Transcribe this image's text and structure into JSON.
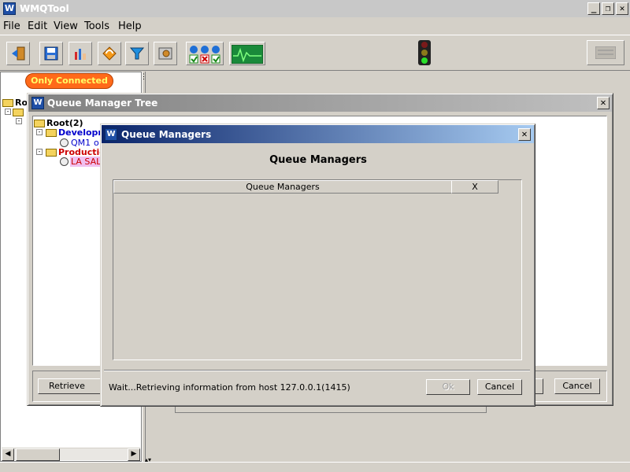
{
  "app": {
    "title": "WMQTool",
    "logo_letter": "W"
  },
  "window_controls": {
    "minimize": "_",
    "restore": "❐",
    "close": "✕"
  },
  "menu": {
    "items": [
      "File",
      "Edit",
      "View",
      "Tools",
      "Help"
    ]
  },
  "toolbar": {
    "icons": [
      "exit-icon",
      "save-icon",
      "chart-hand-icon",
      "refresh-icon",
      "filter-icon",
      "settings-icon",
      "connection-status-icon",
      "monitor-icon"
    ],
    "traffic_light": "traffic-light-icon",
    "right_button": "panel-icon"
  },
  "filter_badge": {
    "label": "Only Connected",
    "color": "#ff6a1a"
  },
  "left_tree": {
    "root_fragment": "Ro"
  },
  "qm_tree_dialog": {
    "title": "Queue Manager Tree",
    "root": "Root(2)",
    "groups": [
      {
        "label": "Developm",
        "color": "#0000cc",
        "children": [
          "QM1",
          "o"
        ]
      },
      {
        "label": "Production",
        "color": "#cc0000",
        "children": [
          "LA SAL"
        ]
      }
    ],
    "buttons": {
      "retrieve": "Retrieve Queu",
      "cancel": "Cancel"
    }
  },
  "qm_dialog": {
    "title": "Queue Managers",
    "heading": "Queue Managers",
    "columns": [
      "Queue Managers",
      "X"
    ],
    "status": "Wait...Retrieving information from host 127.0.0.1(1415)",
    "buttons": {
      "ok": "Ok",
      "cancel": "Cancel"
    }
  }
}
